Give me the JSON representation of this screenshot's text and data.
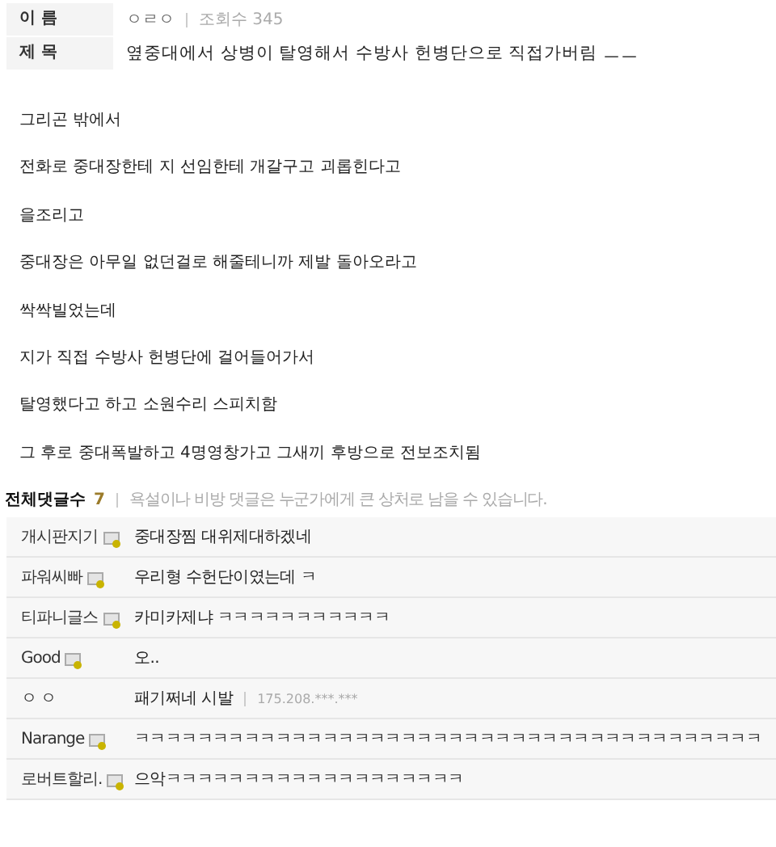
{
  "post": {
    "name_label": "이 름",
    "author": "ㅇㄹㅇ",
    "views_label": "조회수",
    "views": "345",
    "title_label": "제 목",
    "title": "옆중대에서 상병이 탈영해서 수방사 헌병단으로 직접가버림 ㅡㅡ"
  },
  "body": [
    "그리곤 밖에서",
    "전화로 중대장한테 지 선임한테 개갈구고 괴롭힌다고",
    "을조리고",
    "중대장은 아무일 없던걸로 해줄테니까 제발 돌아오라고",
    "싹싹빌었는데",
    "지가 직접 수방사 헌병단에 걸어들어가서",
    "탈영했다고 하고 소원수리 스피치함",
    "그 후로 중대폭발하고 4명영창가고 그새끼 후방으로 전보조치됨"
  ],
  "comments_header": {
    "label": "전체댓글수",
    "count": "7",
    "notice": "욕설이나 비방 댓글은 누군가에게 큰 상처로 남을 수 있습니다."
  },
  "comments": [
    {
      "name": "개시판지기",
      "member": true,
      "text": "중대장찜 대위제대하겠네"
    },
    {
      "name": "파워씨빠",
      "member": true,
      "text": "우리형 수헌단이였는데 ㅋ"
    },
    {
      "name": "티파니글스",
      "member": true,
      "text": "카미카제냐 ㅋㅋㅋㅋㅋㅋㅋㅋㅋㅋㅋ"
    },
    {
      "name": "Good",
      "member": true,
      "text": "오.."
    },
    {
      "name": "ㅇ ㅇ",
      "member": false,
      "text": "패기쩌네 시발",
      "ip": "175.208.***.***"
    },
    {
      "name": "Narange",
      "member": true,
      "text": "ㅋㅋㅋㅋㅋㅋㅋㅋㅋㅋㅋㅋㅋㅋㅋㅋㅋㅋㅋㅋㅋㅋㅋㅋㅋㅋㅋㅋㅋㅋㅋㅋㅋㅋㅋㅋㅋㅋㅋㅋ"
    },
    {
      "name": "로버트할리.",
      "member": true,
      "text": "으악ㅋㅋㅋㅋㅋㅋㅋㅋㅋㅋㅋㅋㅋㅋㅋㅋㅋㅋㅋ"
    }
  ]
}
